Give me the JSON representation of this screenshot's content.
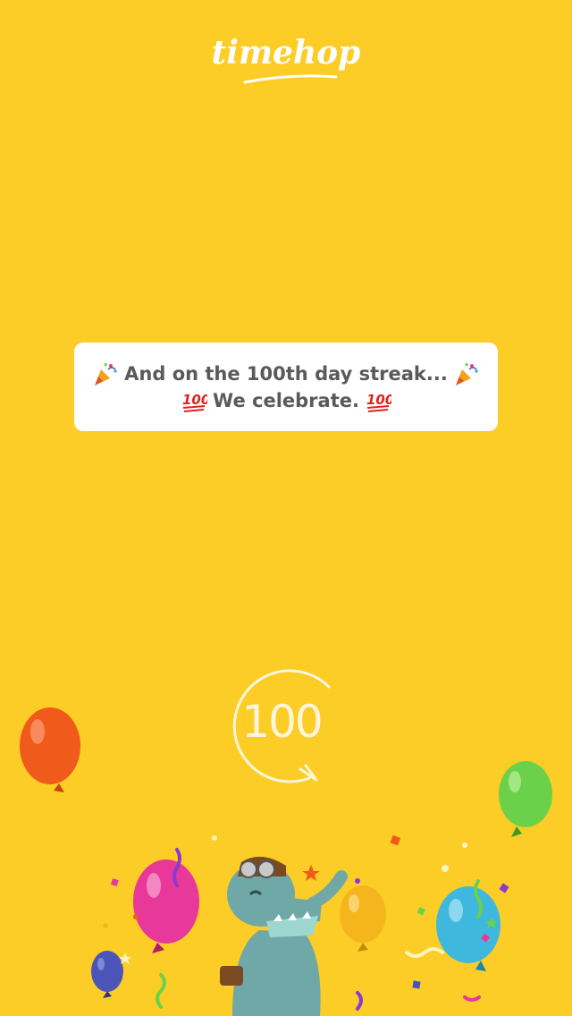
{
  "header": {
    "logo_text": "timehop"
  },
  "message": {
    "line1": "And on the 100th day streak...",
    "line2": "We celebrate."
  },
  "streak": {
    "label": "100"
  },
  "icons": {
    "logo": "timehop-logo",
    "party_popper": "party-popper-emoji",
    "hundred": "hundred-points-emoji",
    "streak_circle": "streak-circle-arrow-icon",
    "mascot": "dinosaur-mascot",
    "balloons": "balloon-icon",
    "confetti": "confetti-decoration"
  },
  "colors": {
    "background": "#FBCD26",
    "card": "#FFFFFF",
    "text": "#5A5A5A",
    "balloon_orange": "#F05A1A",
    "balloon_green": "#6BD14A",
    "balloon_pink": "#E8389A",
    "balloon_blue": "#3FB8DE",
    "balloon_navy": "#4B55B8",
    "balloon_yellow": "#F5B51C",
    "mascot": "#6FA8A6"
  }
}
